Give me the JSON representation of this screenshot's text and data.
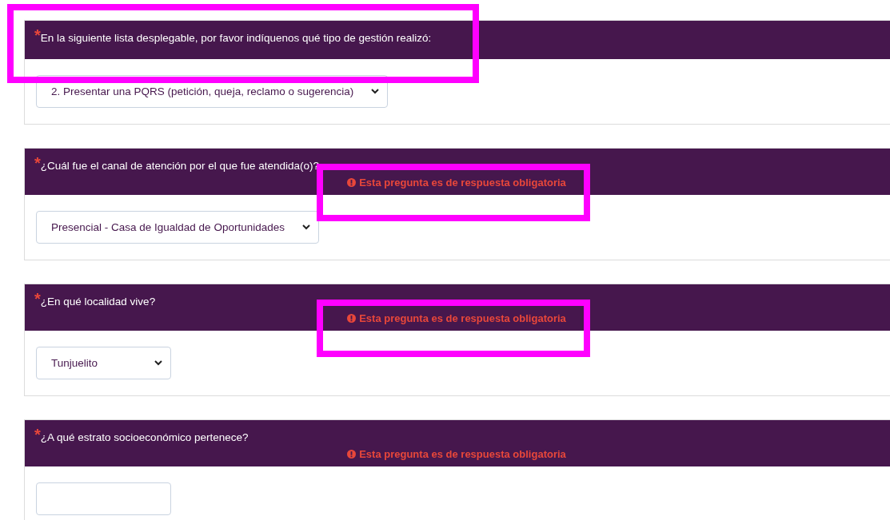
{
  "questions": [
    {
      "required_mark": "*",
      "title": "En la siguiente lista desplegable, por favor indíquenos qué tipo de gestión realizó:",
      "title_highlighted": true,
      "error_highlighted": false,
      "answer": "2. Presentar una PQRS (petición, queja, reclamo o sugerencia)"
    },
    {
      "required_mark": "*",
      "title": "¿Cuál fue el canal de atención por el que fue atendida(o)?",
      "title_highlighted": false,
      "error": "Esta pregunta es de respuesta obligatoria",
      "error_highlighted": true,
      "answer": "Presencial - Casa de Igualdad de Oportunidades"
    },
    {
      "required_mark": "*",
      "title": "¿En qué localidad vive?",
      "title_highlighted": false,
      "error": "Esta pregunta es de respuesta obligatoria",
      "error_highlighted": true,
      "answer": "Tunjuelito"
    },
    {
      "required_mark": "*",
      "title": "¿A qué estrato socioeconómico pertenece?",
      "title_highlighted": false,
      "error": "Esta pregunta es de respuesta obligatoria",
      "error_highlighted": false
    }
  ]
}
